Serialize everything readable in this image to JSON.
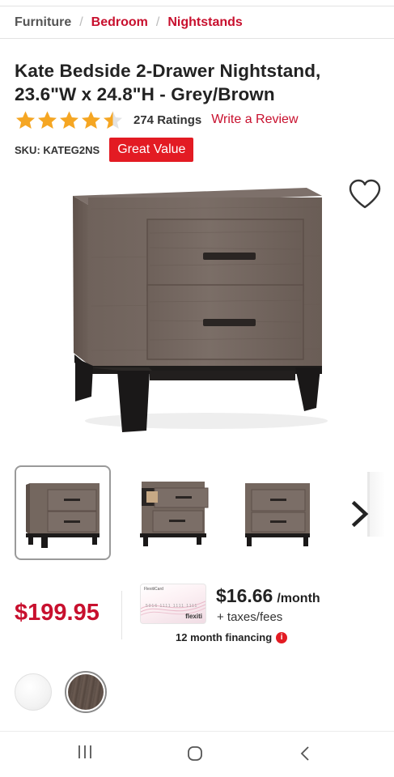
{
  "breadcrumb": {
    "root": "Furniture",
    "level1": "Bedroom",
    "level2": "Nightstands",
    "separator": "/"
  },
  "product": {
    "title_line1": "Kate Bedside 2-Drawer Nightstand,",
    "title_line2": "23.6\"W x 24.8\"H - Grey/Brown",
    "rating_value": 4.5,
    "rating_max": 5,
    "ratings_count": "274 Ratings",
    "write_review": "Write a Review",
    "sku": "SKU: KATEG2NS",
    "badge": "Great Value"
  },
  "pricing": {
    "price": "$199.95",
    "monthly_amount": "$16.66",
    "monthly_unit": "/month",
    "taxes": "+ taxes/fees",
    "financing": "12 month financing",
    "card_label": "FlexitiCard",
    "card_brand": "flexiti",
    "card_number": "5016 1111 1111 1111"
  },
  "colors": {
    "accent": "#c8102e",
    "badge": "#e31b23",
    "wood_grey": "#6b5d55",
    "base_black": "#1c1c1c"
  },
  "icons": {
    "favorite": "heart-outline-icon",
    "next": "chevron-right-icon",
    "info": "info-icon",
    "nav_recent": "recent-apps-icon",
    "nav_home": "home-icon",
    "nav_back": "back-icon"
  },
  "thumbnails": [
    {
      "name": "front-view",
      "selected": true
    },
    {
      "name": "open-drawer-view",
      "selected": false
    },
    {
      "name": "straight-front-view",
      "selected": false
    }
  ],
  "swatches": [
    {
      "name": "white",
      "selected": false
    },
    {
      "name": "grey-brown",
      "selected": true
    }
  ]
}
